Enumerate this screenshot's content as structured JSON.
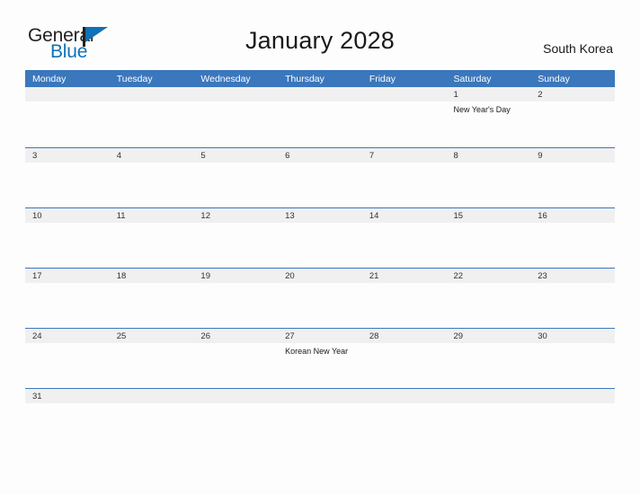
{
  "brand": {
    "name_part1": "General",
    "name_part2": "Blue",
    "flag_icon": "flag-icon",
    "accent_color": "#1071b8"
  },
  "header": {
    "title": "January 2028",
    "country": "South Korea"
  },
  "theme": {
    "header_blue": "#3b77bc",
    "band_gray": "#f0f0f0",
    "page_background": "#fdfdfd",
    "text_color": "#303030"
  },
  "calendar": {
    "month": "January",
    "year": "2028",
    "weekdays": [
      "Monday",
      "Tuesday",
      "Wednesday",
      "Thursday",
      "Friday",
      "Saturday",
      "Sunday"
    ],
    "weeks": [
      {
        "days": [
          {
            "num": "",
            "event": ""
          },
          {
            "num": "",
            "event": ""
          },
          {
            "num": "",
            "event": ""
          },
          {
            "num": "",
            "event": ""
          },
          {
            "num": "",
            "event": ""
          },
          {
            "num": "1",
            "event": "New Year's Day"
          },
          {
            "num": "2",
            "event": ""
          }
        ]
      },
      {
        "days": [
          {
            "num": "3",
            "event": ""
          },
          {
            "num": "4",
            "event": ""
          },
          {
            "num": "5",
            "event": ""
          },
          {
            "num": "6",
            "event": ""
          },
          {
            "num": "7",
            "event": ""
          },
          {
            "num": "8",
            "event": ""
          },
          {
            "num": "9",
            "event": ""
          }
        ]
      },
      {
        "days": [
          {
            "num": "10",
            "event": ""
          },
          {
            "num": "11",
            "event": ""
          },
          {
            "num": "12",
            "event": ""
          },
          {
            "num": "13",
            "event": ""
          },
          {
            "num": "14",
            "event": ""
          },
          {
            "num": "15",
            "event": ""
          },
          {
            "num": "16",
            "event": ""
          }
        ]
      },
      {
        "days": [
          {
            "num": "17",
            "event": ""
          },
          {
            "num": "18",
            "event": ""
          },
          {
            "num": "19",
            "event": ""
          },
          {
            "num": "20",
            "event": ""
          },
          {
            "num": "21",
            "event": ""
          },
          {
            "num": "22",
            "event": ""
          },
          {
            "num": "23",
            "event": ""
          }
        ]
      },
      {
        "days": [
          {
            "num": "24",
            "event": ""
          },
          {
            "num": "25",
            "event": ""
          },
          {
            "num": "26",
            "event": ""
          },
          {
            "num": "27",
            "event": "Korean New Year"
          },
          {
            "num": "28",
            "event": ""
          },
          {
            "num": "29",
            "event": ""
          },
          {
            "num": "30",
            "event": ""
          }
        ]
      },
      {
        "days": [
          {
            "num": "31",
            "event": ""
          },
          {
            "num": "",
            "event": ""
          },
          {
            "num": "",
            "event": ""
          },
          {
            "num": "",
            "event": ""
          },
          {
            "num": "",
            "event": ""
          },
          {
            "num": "",
            "event": ""
          },
          {
            "num": "",
            "event": ""
          }
        ]
      }
    ]
  }
}
